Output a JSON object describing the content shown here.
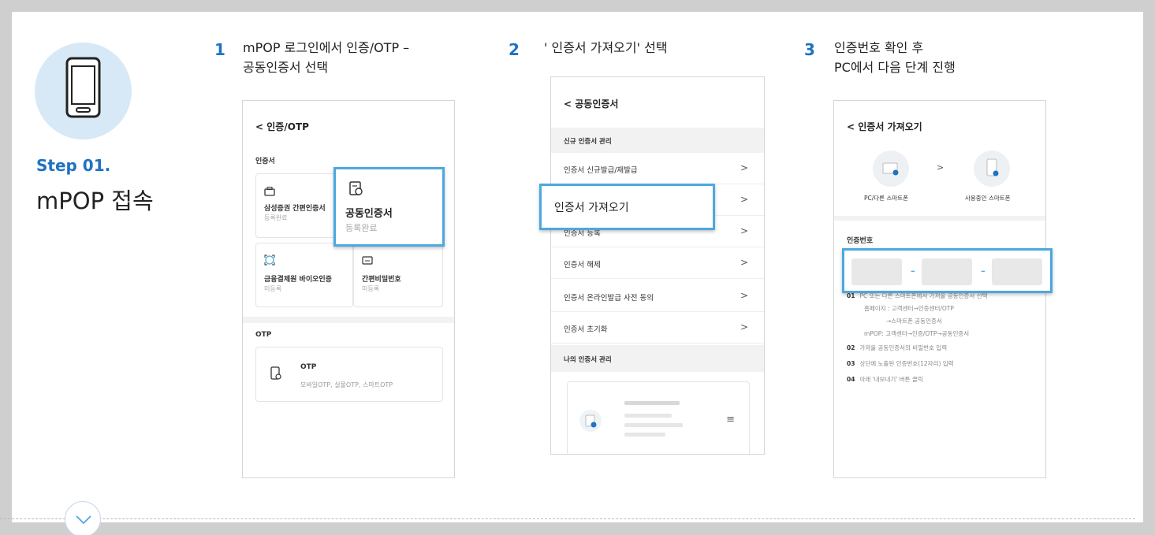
{
  "left": {
    "step_label": "Step 01.",
    "step_title": "mPOP 접속",
    "phone_icon": "smartphone-icon",
    "down_icon": "chevron-down-icon"
  },
  "steps": [
    {
      "num": "1",
      "line1": "mPOP 로그인에서 인증/OTP –",
      "line2": "공동인증서 선택"
    },
    {
      "num": "2",
      "line1": "' 인증서 가져오기' 선택",
      "line2": ""
    },
    {
      "num": "3",
      "line1": "인증번호 확인 후",
      "line2": "PC에서 다음 단계 진행"
    }
  ],
  "screen1": {
    "title": "< 인증/OTP",
    "section_cert": "인증서",
    "card1_title": "삼성증권 간편인증서",
    "card1_sub": "등록완료",
    "highlight_title": "공동인증서",
    "highlight_sub": "등록완료",
    "card3_title": "금융결제원 바이오인증",
    "card3_sub": "미등록",
    "card4_title": "간편비밀번호",
    "card4_sub": "미등록",
    "section_otp": "OTP",
    "otp_title": "OTP",
    "otp_sub": "모바일OTP, 실물OTP, 스마트OTP"
  },
  "screen2": {
    "title": "< 공동인증서",
    "section_new": "신규 인증서 관리",
    "rows": [
      "인증서 신규발급/재발급",
      "",
      "인증서 등록",
      "인증서 해제",
      "인증서 온라인발급 사전 동의",
      "인증서 초기화"
    ],
    "highlight": "인증서 가져오기",
    "section_mine": "나의 인증서 관리",
    "menu_icon": "≡",
    "arrow": ">"
  },
  "screen3": {
    "title": "< 인증서 가져오기",
    "from_label": "PC/다른 스마트폰",
    "to_label": "사용중인 스마트폰",
    "arrow": ">",
    "code_label": "인증번호",
    "dash": "-",
    "notes": [
      {
        "n": "01",
        "t": "PC 또는 다른 스마트폰에서 가져올 공동인증서 선택"
      },
      {
        "n": "",
        "t": "홈페이지 : 고객센터→인증센터/OTP"
      },
      {
        "n": "",
        "t": "→스마트폰 공동인증서"
      },
      {
        "n": "",
        "t": "mPOP: 고객센터→인증/OTP→공동인증서"
      },
      {
        "n": "02",
        "t": "가져올 공동인증서의 비밀번호 입력"
      },
      {
        "n": "03",
        "t": "상단에 노출된 인증번호(12자리) 입력"
      },
      {
        "n": "04",
        "t": "아래 '내보내기' 버튼 클릭"
      }
    ]
  },
  "colors": {
    "accent": "#1f72c4",
    "highlight": "#4ba8e0",
    "circle": "#d7e9f6"
  }
}
